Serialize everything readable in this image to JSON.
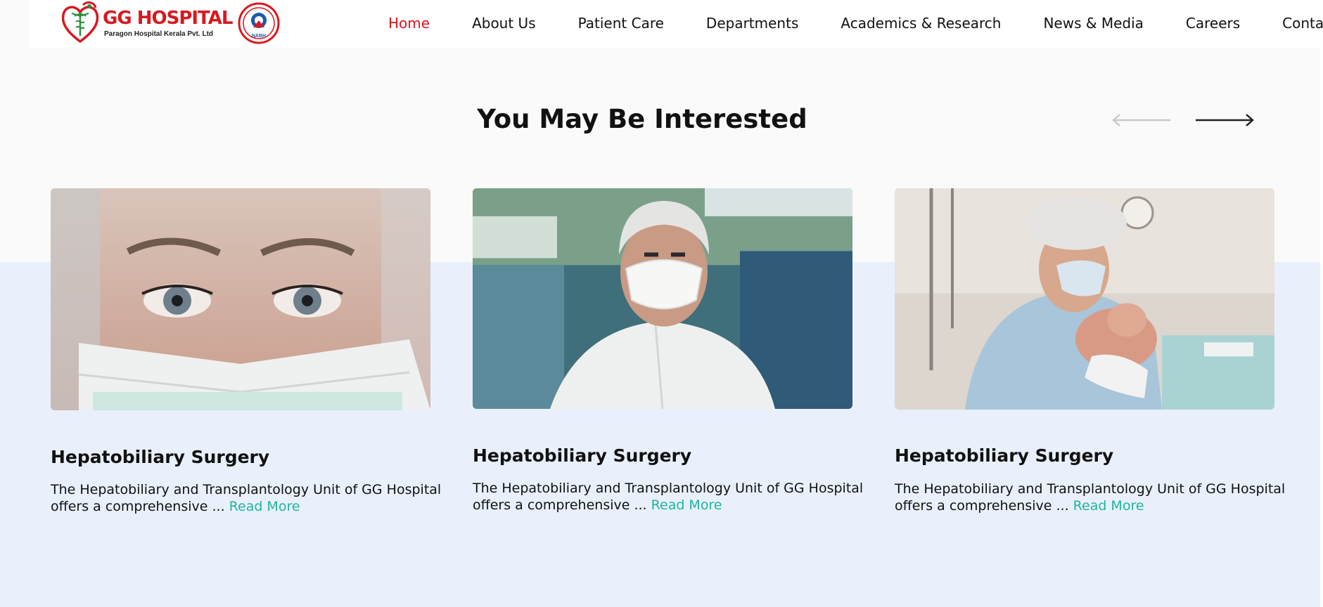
{
  "brand": {
    "logo_text": "GG HOSPITAL",
    "logo_subtext": "Paragon Hospital Kerala Pvt. Ltd",
    "badge_text": "NABH",
    "brand_red": "#d71920"
  },
  "nav": {
    "items": [
      {
        "label": "Home",
        "active": true
      },
      {
        "label": "About Us"
      },
      {
        "label": "Patient Care"
      },
      {
        "label": "Departments"
      },
      {
        "label": "Academics & Research"
      },
      {
        "label": "News & Media"
      },
      {
        "label": "Careers"
      },
      {
        "label": "Contact Us"
      }
    ],
    "active_color": "#e3141b"
  },
  "section": {
    "title": "You May Be Interested",
    "prev_icon": "arrow-left-icon",
    "next_icon": "arrow-right-icon"
  },
  "cards": [
    {
      "image": "nurse-eyes-face-mask-photo",
      "title": "Hepatobiliary Surgery",
      "text": "The Hepatobiliary and Transplantology Unit of GG Hospital offers a comprehensive ...",
      "link": "Read More"
    },
    {
      "image": "older-man-n95-mask-photo",
      "title": "Hepatobiliary Surgery",
      "text": "The Hepatobiliary and Transplantology Unit of GG Hospital offers a comprehensive ...",
      "link": "Read More"
    },
    {
      "image": "surgeon-holding-newborn-photo",
      "title": "Hepatobiliary Surgery",
      "text": "The Hepatobiliary and Transplantology Unit of GG Hospital offers a comprehensive ...",
      "link": "Read More"
    }
  ],
  "colors": {
    "link": "#1fb5a0",
    "band": "#e9f0fc"
  }
}
